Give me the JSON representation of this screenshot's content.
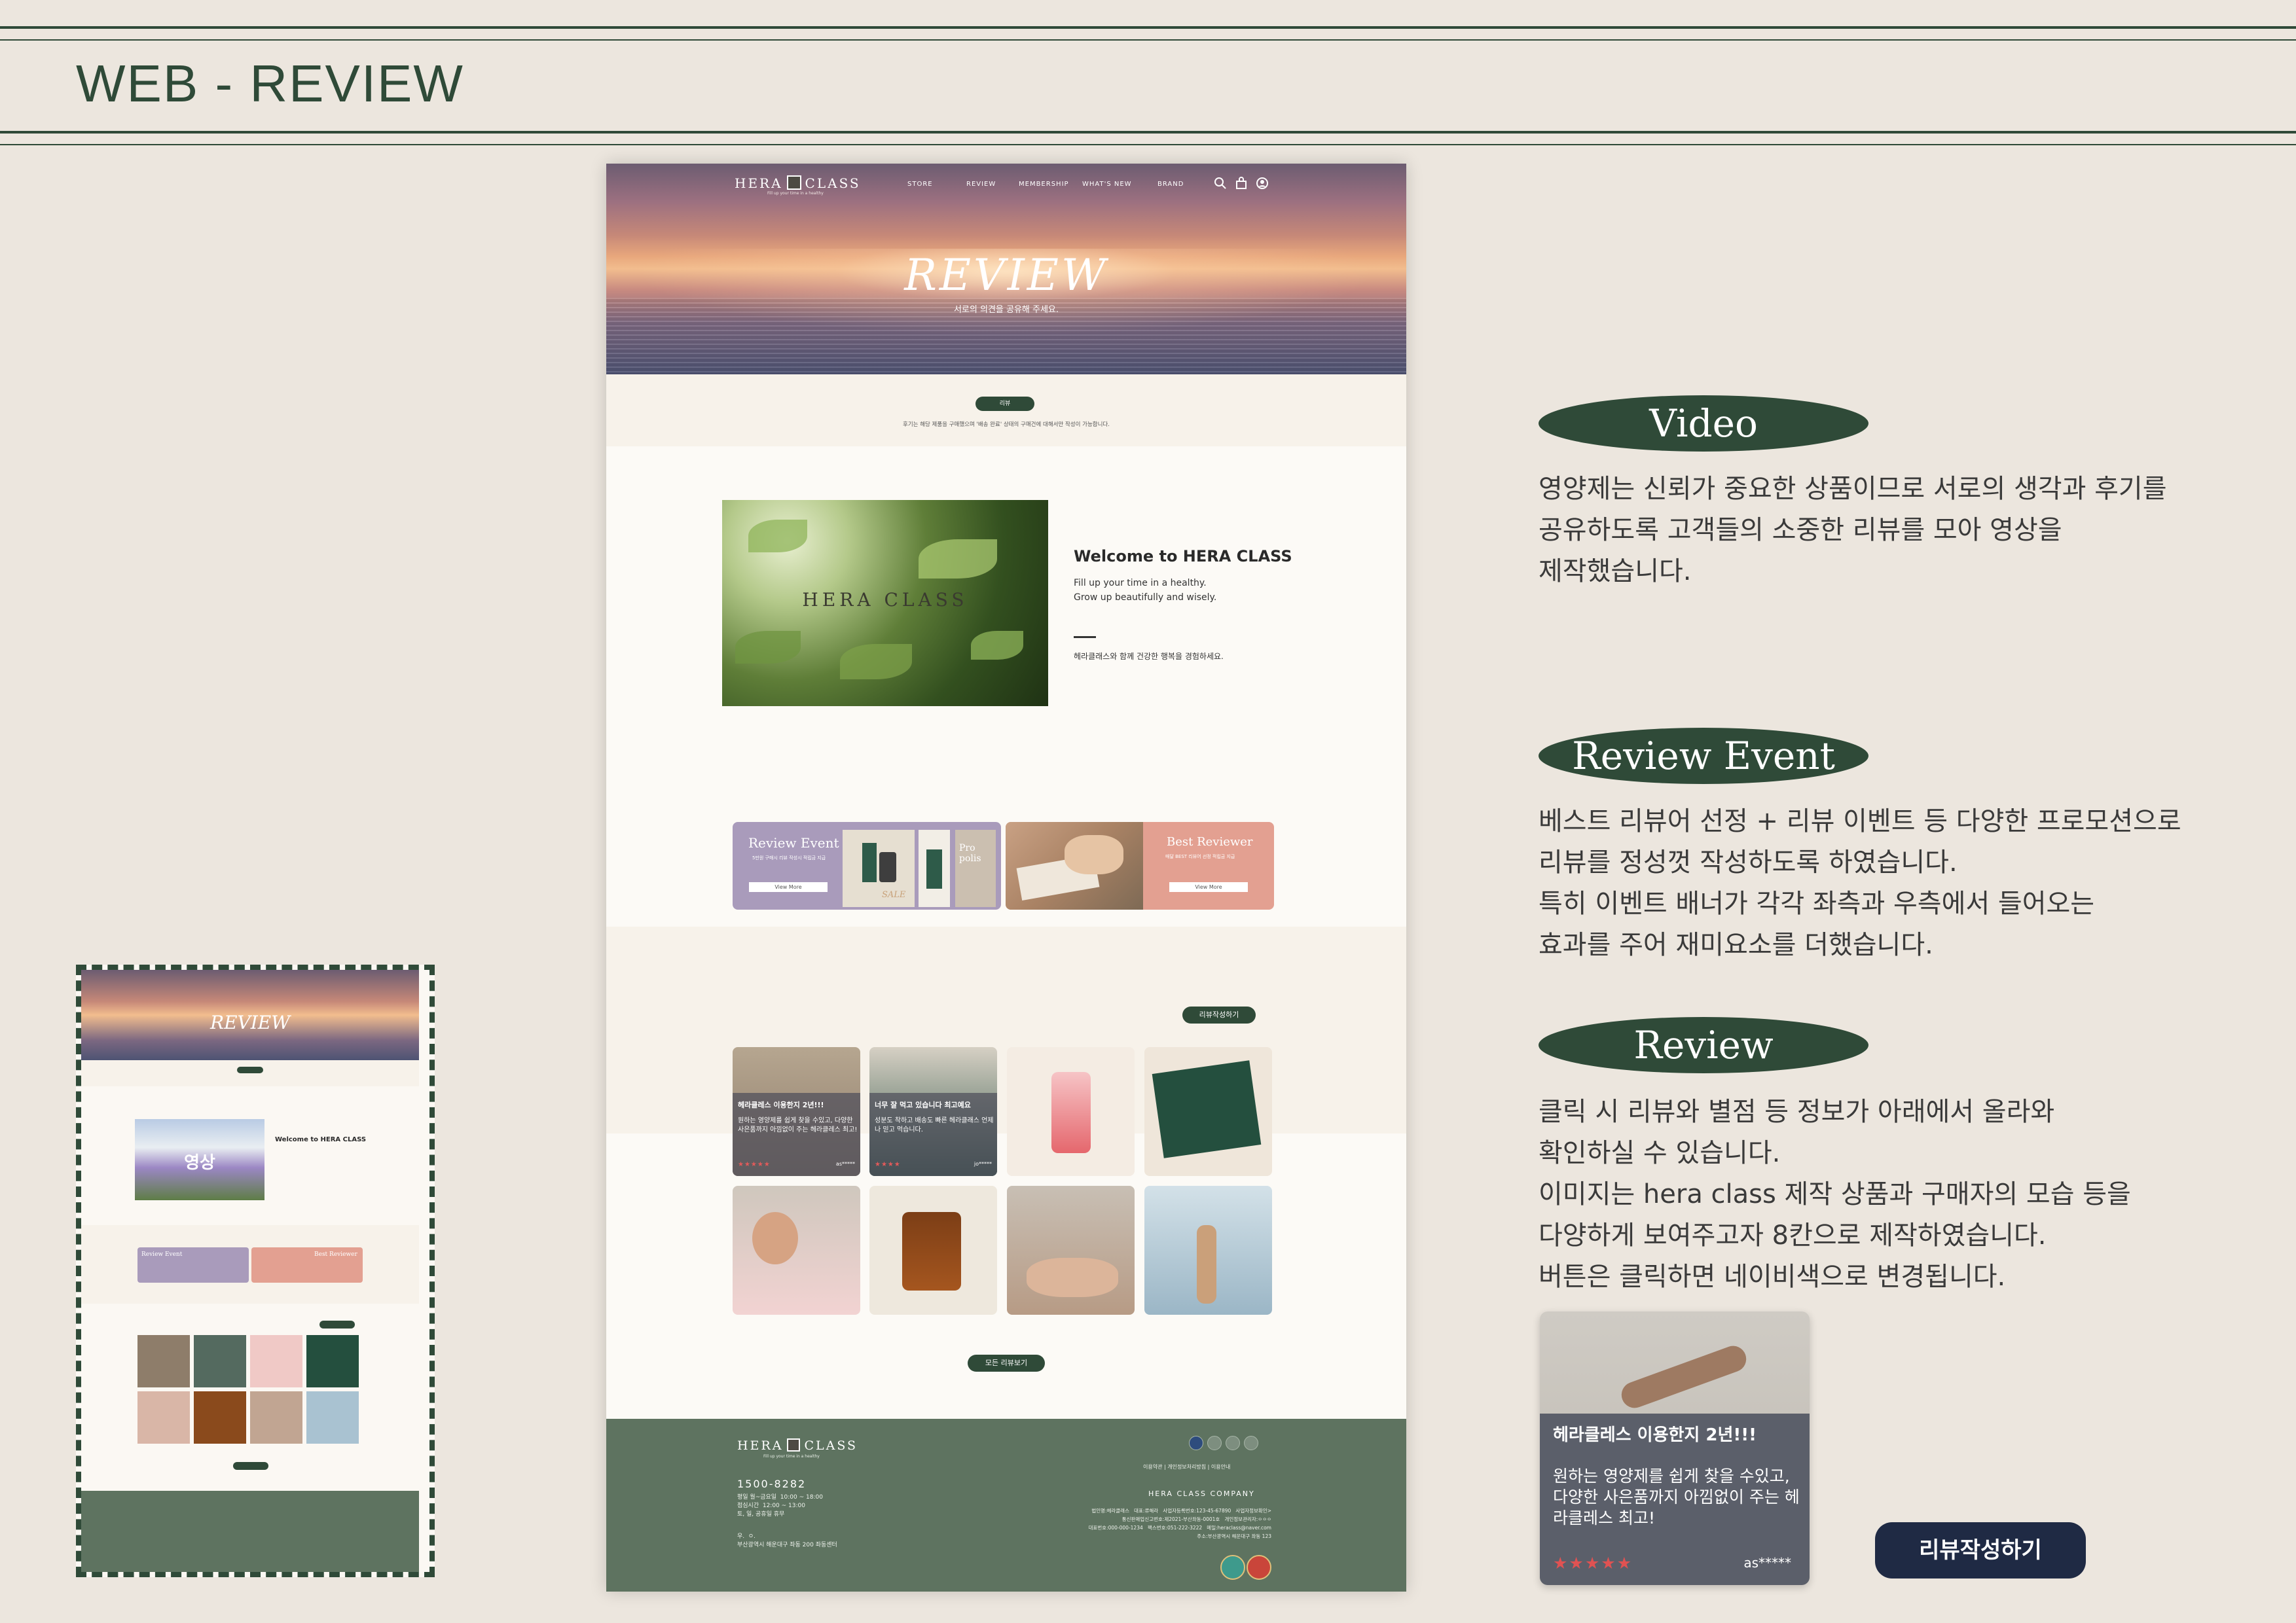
{
  "page": {
    "title": "WEB - REVIEW"
  },
  "nav": {
    "logo_left": "HERA",
    "logo_right": "CLASS",
    "tagline": "Fill up your time in a healthy",
    "items": [
      "STORE",
      "REVIEW",
      "MEMBERSHIP",
      "WHAT'S NEW",
      "BRAND"
    ]
  },
  "hero": {
    "title": "REVIEW",
    "subtitle": "서로의 의견을 공유해 주세요."
  },
  "review_intro": {
    "tab": "리뷰",
    "note": "후기는 해당 제품을 구매했으며 '배송 완료' 상태의 구매건에 대해서만 작성이 가능합니다."
  },
  "video_section": {
    "logo": "HERA CLASS",
    "heading": "Welcome to HERA CLASS",
    "line1": "Fill up your time in a healthy.",
    "line2": "Grow up beautifully and wisely.",
    "korean": "헤라클래스와 함께 건강한 행복을 경험하세요."
  },
  "banners": {
    "event": {
      "title": "Review Event",
      "subtitle": "5만원 구매시 리뷰 작성시 적립금 지급",
      "button": "View More",
      "product1": "Pro polis",
      "tag": "SALE"
    },
    "best": {
      "title": "Best Reviewer",
      "subtitle": "매달 BEST 리뷰어 선정 적립금 지급",
      "button": "View More"
    }
  },
  "reviews": {
    "write_button": "리뷰작성하기",
    "all_button": "모든 리뷰보기",
    "cards": [
      {
        "title": "헤라클레스 이용한지 2년!!!",
        "desc": "원하는 영양제를 쉽게 찾을 수있고, 다양한 사은품까지 아낌없이 주는 헤라클레스 최고!",
        "stars": "★★★★★",
        "user": "as*****"
      },
      {
        "title": "너무 잘 먹고 있습니다 최고예요",
        "desc": "성분도 착하고 배송도 빠른 헤라클래스 언제나 믿고 먹습니다.",
        "stars": "★★★★",
        "user": "jo*****"
      }
    ]
  },
  "footer": {
    "logo_left": "HERA",
    "logo_right": "CLASS",
    "tagline": "Fill up your time in a healthy",
    "phone": "1500-8282",
    "hours": "평일 월~금요일  10:00 ~ 18:00\n점심시간  12:00 ~ 13:00\n토, 일, 공휴일 휴무",
    "address": "우.  ㅇ.\n부산광역시 해운대구 좌동 200 좌동센터",
    "links": "이용약관  |  개인정보처리방침  |  이용안내",
    "company": "HERA CLASS COMPANY",
    "info": "법인명:헤라클래스   대표:류해라   사업자등록번호:123-45-67890   사업자정보확인&gt;\n통신판매업신고번호:제2021-부산좌동-0001호   개인정보관리자:ㅇㅇㅇ\n대표번호:000-000-1234   팩스번호:051-222-3222   메일:heraclass@naver.com\n주소:부산광역시 해운대구 좌동 123"
  },
  "notes": {
    "video": {
      "label": "Video",
      "text": "영양제는 신뢰가 중요한 상품이므로 서로의 생각과 후기를\n공유하도록 고객들의 소중한 리뷰를 모아 영상을\n제작했습니다."
    },
    "event": {
      "label": "Review Event",
      "text": "베스트 리뷰어 선정 + 리뷰 이벤트 등 다양한 프로모션으로\n리뷰를 정성껏 작성하도록 하였습니다.\n특히 이벤트 배너가 각각 좌측과 우측에서 들어오는\n효과를 주어 재미요소를 더했습니다."
    },
    "review": {
      "label": "Review",
      "text": "클릭 시 리뷰와 별점 등 정보가 아래에서 올라와\n확인하실 수 있습니다.\n이미지는 hera class 제작 상품과 구매자의 모습 등을\n다양하게 보여주고자 8칸으로 제작하였습니다.\n버튼은 클릭하면 네이비색으로 변경됩니다."
    }
  },
  "thumbnail": {
    "hero_title": "REVIEW",
    "video_label": "영상",
    "welcome": "Welcome to HERA CLASS",
    "event": "Review Event",
    "best": "Best Reviewer"
  },
  "colors": {
    "accent": "#2f4a38",
    "navy": "#1f2a44",
    "footer": "#5e7360",
    "event_banner": "#a99bbb",
    "best_banner": "#e3a091"
  }
}
